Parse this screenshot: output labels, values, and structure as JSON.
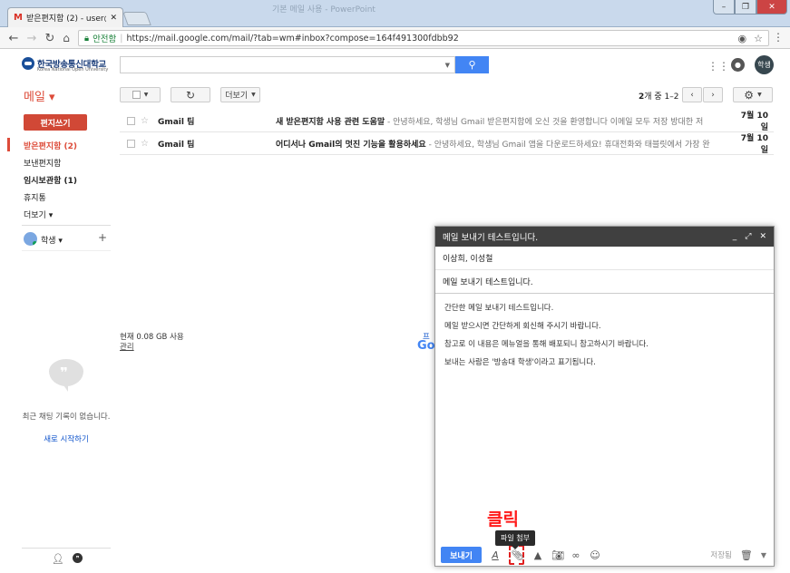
{
  "browser": {
    "tab_title": "받은편지함 (2) - user@",
    "ghost_title": "기본 메일 사용 - PowerPoint",
    "secure_label": "안전함",
    "url": "https://mail.google.com/mail/?tab=wm#inbox?compose=164f491300fdbb92"
  },
  "header": {
    "logo_text": "한국방송통신대학교",
    "logo_sub": "Korea National Open University",
    "avatar_label": "학생"
  },
  "toolbar": {
    "mail_label": "메일 ▾",
    "more_label": "더보기",
    "count_strong": "2",
    "count_text": "개 중 1–2"
  },
  "sidebar": {
    "compose_label": "편지쓰기",
    "items": [
      {
        "label": "받은편지함 (2)"
      },
      {
        "label": "보낸편지함"
      },
      {
        "label": "임시보관함 (1)"
      },
      {
        "label": "휴지통"
      },
      {
        "label": "더보기 ▾"
      }
    ],
    "hangout_user": "학생 ▾",
    "no_chat": "최근 채팅 기록이 없습니다.",
    "new_chat": "새로 시작하기"
  },
  "mails": [
    {
      "from": "Gmail 팀",
      "subject": "새 받은편지함 사용 관련 도움말",
      "snippet": " - 안녕하세요, 학생님 Gmail 받은편지함에 오신 것을 환영합니다 이메일 모두 저장 방대한 저",
      "date": "7월 10일"
    },
    {
      "from": "Gmail 팀",
      "subject": "어디서나 Gmail의 멋진 기능을 활용하세요",
      "snippet": " - 안녕하세요, 학생님 Gmail 앱을 다운로드하세요! 휴대전화와 태블릿에서 가장 완",
      "date": "7월 10일"
    }
  ],
  "storage": {
    "usage": "현재 0.08 GB 사용",
    "manage": "관리",
    "peek_link": "프",
    "peek_logo": "Go"
  },
  "compose": {
    "title": "메일 보내기 테스트입니다.",
    "to": "이상희, 이성철",
    "subject": "메일 보내기 테스트입니다.",
    "body": [
      "간단한 메일 보내기 테스트입니다.",
      "메일 받으시면 간단하게 회신해 주시기 바랍니다.",
      "참고로 이 내용은 메뉴얼을 통해 배포되니 참고하시기 바랍니다.",
      "보내는 사람은 '방송대 학생'이라고 표기됩니다."
    ],
    "send_label": "보내기",
    "saved_label": "저장됨",
    "attach_tooltip": "파일 첨부"
  },
  "annotation": {
    "click_label": "클릭",
    "color": "#ff1a1a"
  },
  "colors": {
    "accent_red": "#dd4b39",
    "compose_red": "#d14836",
    "blue": "#4285f4"
  }
}
